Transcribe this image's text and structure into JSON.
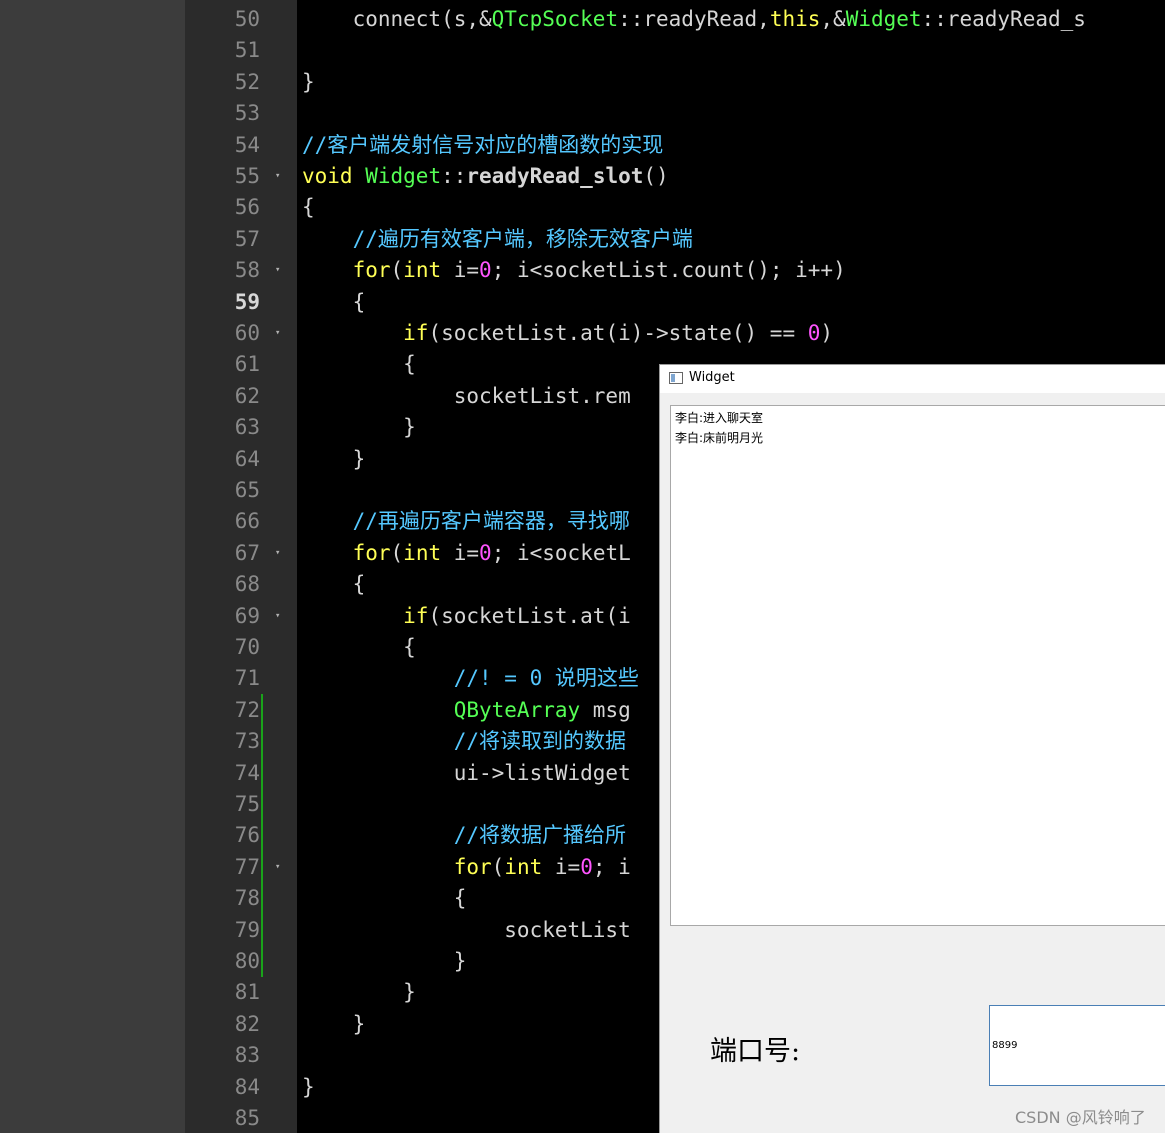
{
  "editor": {
    "lines": [
      {
        "no": "50",
        "code": [
          [
            "",
            "    connect(s,&amp;"
          ],
          [
            "ty",
            "QTcpSocket"
          ],
          [
            "",
            "::readyRead,"
          ],
          [
            "kw",
            "this"
          ],
          [
            "",
            ",&amp;"
          ],
          [
            "ty",
            "Widget"
          ],
          [
            "",
            "::readyRead_s"
          ]
        ]
      },
      {
        "no": "51",
        "code": []
      },
      {
        "no": "52",
        "code": [
          [
            "",
            "}"
          ]
        ]
      },
      {
        "no": "53",
        "code": []
      },
      {
        "no": "54",
        "code": [
          [
            "cm",
            "//客户端发射信号对应的槽函数的实现"
          ]
        ]
      },
      {
        "no": "55",
        "fold": true,
        "code": [
          [
            "kw",
            "void"
          ],
          [
            "",
            " "
          ],
          [
            "ty",
            "Widget"
          ],
          [
            "",
            "::"
          ],
          [
            "b",
            "readyRead_slot"
          ],
          [
            "",
            "()"
          ]
        ]
      },
      {
        "no": "56",
        "code": [
          [
            "",
            "{"
          ]
        ]
      },
      {
        "no": "57",
        "code": [
          [
            "cm",
            "    //遍历有效客户端，移除无效客户端"
          ]
        ]
      },
      {
        "no": "58",
        "fold": true,
        "code": [
          [
            "kw",
            "    for"
          ],
          [
            "",
            "("
          ],
          [
            "kw",
            "int"
          ],
          [
            "",
            " i="
          ],
          [
            "num",
            "0"
          ],
          [
            "",
            "; i&lt;socketList.count(); i++)"
          ]
        ]
      },
      {
        "no": "59",
        "current": true,
        "code": [
          [
            "",
            "    {"
          ]
        ]
      },
      {
        "no": "60",
        "fold": true,
        "code": [
          [
            "kw",
            "        if"
          ],
          [
            "",
            "(socketList.at(i)-&gt;state() == "
          ],
          [
            "num",
            "0"
          ],
          [
            "",
            ")"
          ]
        ]
      },
      {
        "no": "61",
        "code": [
          [
            "",
            "        {"
          ]
        ]
      },
      {
        "no": "62",
        "code": [
          [
            "",
            "            socketList.rem"
          ]
        ]
      },
      {
        "no": "63",
        "code": [
          [
            "",
            "        }"
          ]
        ]
      },
      {
        "no": "64",
        "code": [
          [
            "",
            "    }"
          ]
        ]
      },
      {
        "no": "65",
        "code": []
      },
      {
        "no": "66",
        "code": [
          [
            "cm",
            "    //再遍历客户端容器，寻找哪"
          ]
        ]
      },
      {
        "no": "67",
        "fold": true,
        "code": [
          [
            "kw",
            "    for"
          ],
          [
            "",
            "("
          ],
          [
            "kw",
            "int"
          ],
          [
            "",
            " i="
          ],
          [
            "num",
            "0"
          ],
          [
            "",
            "; i&lt;socketL"
          ]
        ]
      },
      {
        "no": "68",
        "code": [
          [
            "",
            "    {"
          ]
        ]
      },
      {
        "no": "69",
        "fold": true,
        "code": [
          [
            "kw",
            "        if"
          ],
          [
            "",
            "(socketList.at(i"
          ]
        ]
      },
      {
        "no": "70",
        "code": [
          [
            "",
            "        {"
          ]
        ]
      },
      {
        "no": "71",
        "code": [
          [
            "cm",
            "            //! = 0 说明这些"
          ]
        ]
      },
      {
        "no": "72",
        "mark": true,
        "code": [
          [
            "ty",
            "            QByteArray"
          ],
          [
            "",
            " msg"
          ]
        ]
      },
      {
        "no": "73",
        "mark": true,
        "code": [
          [
            "cm",
            "            //将读取到的数据"
          ]
        ]
      },
      {
        "no": "74",
        "mark": true,
        "code": [
          [
            "",
            "            ui-&gt;listWidget"
          ]
        ]
      },
      {
        "no": "75",
        "mark": true,
        "code": []
      },
      {
        "no": "76",
        "mark": true,
        "code": [
          [
            "cm",
            "            //将数据广播给所"
          ]
        ]
      },
      {
        "no": "77",
        "mark": true,
        "fold": true,
        "code": [
          [
            "kw",
            "            for"
          ],
          [
            "",
            "("
          ],
          [
            "kw",
            "int"
          ],
          [
            "",
            " i="
          ],
          [
            "num",
            "0"
          ],
          [
            "",
            "; i"
          ]
        ]
      },
      {
        "no": "78",
        "mark": true,
        "code": [
          [
            "",
            "            {"
          ]
        ]
      },
      {
        "no": "79",
        "mark": true,
        "code": [
          [
            "",
            "                socketList"
          ]
        ]
      },
      {
        "no": "80",
        "mark": true,
        "code": [
          [
            "",
            "            }"
          ]
        ]
      },
      {
        "no": "81",
        "code": [
          [
            "",
            "        }"
          ]
        ]
      },
      {
        "no": "82",
        "code": [
          [
            "",
            "    }"
          ]
        ]
      },
      {
        "no": "83",
        "code": []
      },
      {
        "no": "84",
        "code": [
          [
            "",
            "}"
          ]
        ]
      },
      {
        "no": "85",
        "code": []
      }
    ]
  },
  "window": {
    "title": "Widget",
    "messages": [
      "李白:进入聊天室",
      "李白:床前明月光"
    ],
    "port_label": "端口号:",
    "port_value": "8899"
  },
  "watermark": "CSDN @风铃响了",
  "colors": {
    "keyword": "#ffff55",
    "type": "#55ff55",
    "number": "#ff55ff",
    "comment": "#55c8ff",
    "text": "#d6d6d6",
    "change_marker": "#1aa31a"
  }
}
